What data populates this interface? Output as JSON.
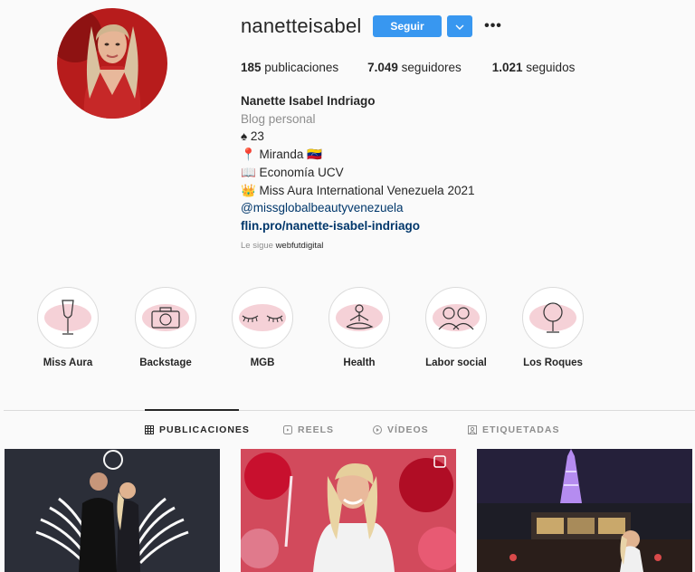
{
  "profile": {
    "username": "nanetteisabel",
    "follow_label": "Seguir",
    "more_icon": "•••",
    "stats": {
      "posts": "185",
      "posts_label": "publicaciones",
      "followers": "7.049",
      "followers_label": "seguidores",
      "following": "1.021",
      "following_label": "seguidos"
    },
    "bio": {
      "full_name": "Nanette Isabel Indriago",
      "category": "Blog personal",
      "line1": "♠ 23",
      "line2": "📍 Miranda 🇻🇪",
      "line3": "📖 Economía UCV",
      "line4": "👑 Miss Aura International Venezuela 2021",
      "mention": "@missglobalbeautyvenezuela",
      "link": "flin.pro/nanette-isabel-indriago"
    },
    "followed_by_prefix": "Le sigue",
    "followed_by_user": "webfutdigital"
  },
  "highlights": [
    {
      "label": "Miss Aura",
      "icon": "champagne-glass-icon"
    },
    {
      "label": "Backstage",
      "icon": "camera-icon"
    },
    {
      "label": "MGB",
      "icon": "eyelashes-icon"
    },
    {
      "label": "Health",
      "icon": "meditation-icon"
    },
    {
      "label": "Labor social",
      "icon": "people-icon"
    },
    {
      "label": "Los Roques",
      "icon": "mirror-icon"
    }
  ],
  "tabs": [
    {
      "label": "PUBLICACIONES",
      "icon": "grid-icon",
      "active": true
    },
    {
      "label": "REELS",
      "icon": "reels-icon",
      "active": false
    },
    {
      "label": "VÍDEOS",
      "icon": "play-icon",
      "active": false
    },
    {
      "label": "ETIQUETADAS",
      "icon": "tag-icon",
      "active": false
    }
  ],
  "colors": {
    "accent": "#3897f0",
    "highlight_blot": "#f2c6cd",
    "link": "#00376b"
  }
}
